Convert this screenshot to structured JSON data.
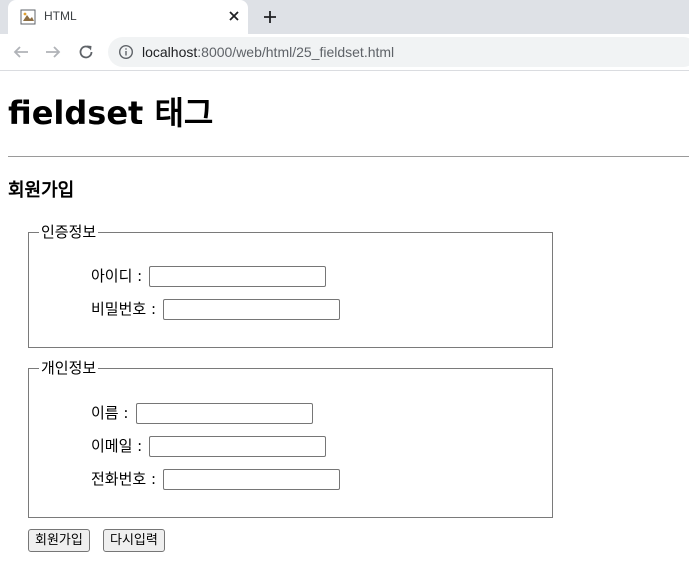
{
  "browser": {
    "tab_title": "HTML",
    "url_host": "localhost",
    "url_path": ":8000/web/html/25_fieldset.html"
  },
  "page": {
    "title": "fieldset 태그",
    "section_title": "회원가입",
    "fieldsets": [
      {
        "legend": "인증정보",
        "fields": [
          {
            "label": "아이디 :",
            "value": ""
          },
          {
            "label": "비밀번호 :",
            "value": ""
          }
        ]
      },
      {
        "legend": "개인정보",
        "fields": [
          {
            "label": "이름 :",
            "value": ""
          },
          {
            "label": "이메일 :",
            "value": ""
          },
          {
            "label": "전화번호 :",
            "value": ""
          }
        ]
      }
    ],
    "buttons": {
      "submit_label": "회원가입",
      "reset_label": "다시입력"
    }
  },
  "icons": {
    "favicon": "html-file-icon",
    "close": "close-icon",
    "new_tab": "plus-icon",
    "back": "back-arrow-icon",
    "forward": "forward-arrow-icon",
    "reload": "reload-icon",
    "site_info": "info-icon"
  }
}
